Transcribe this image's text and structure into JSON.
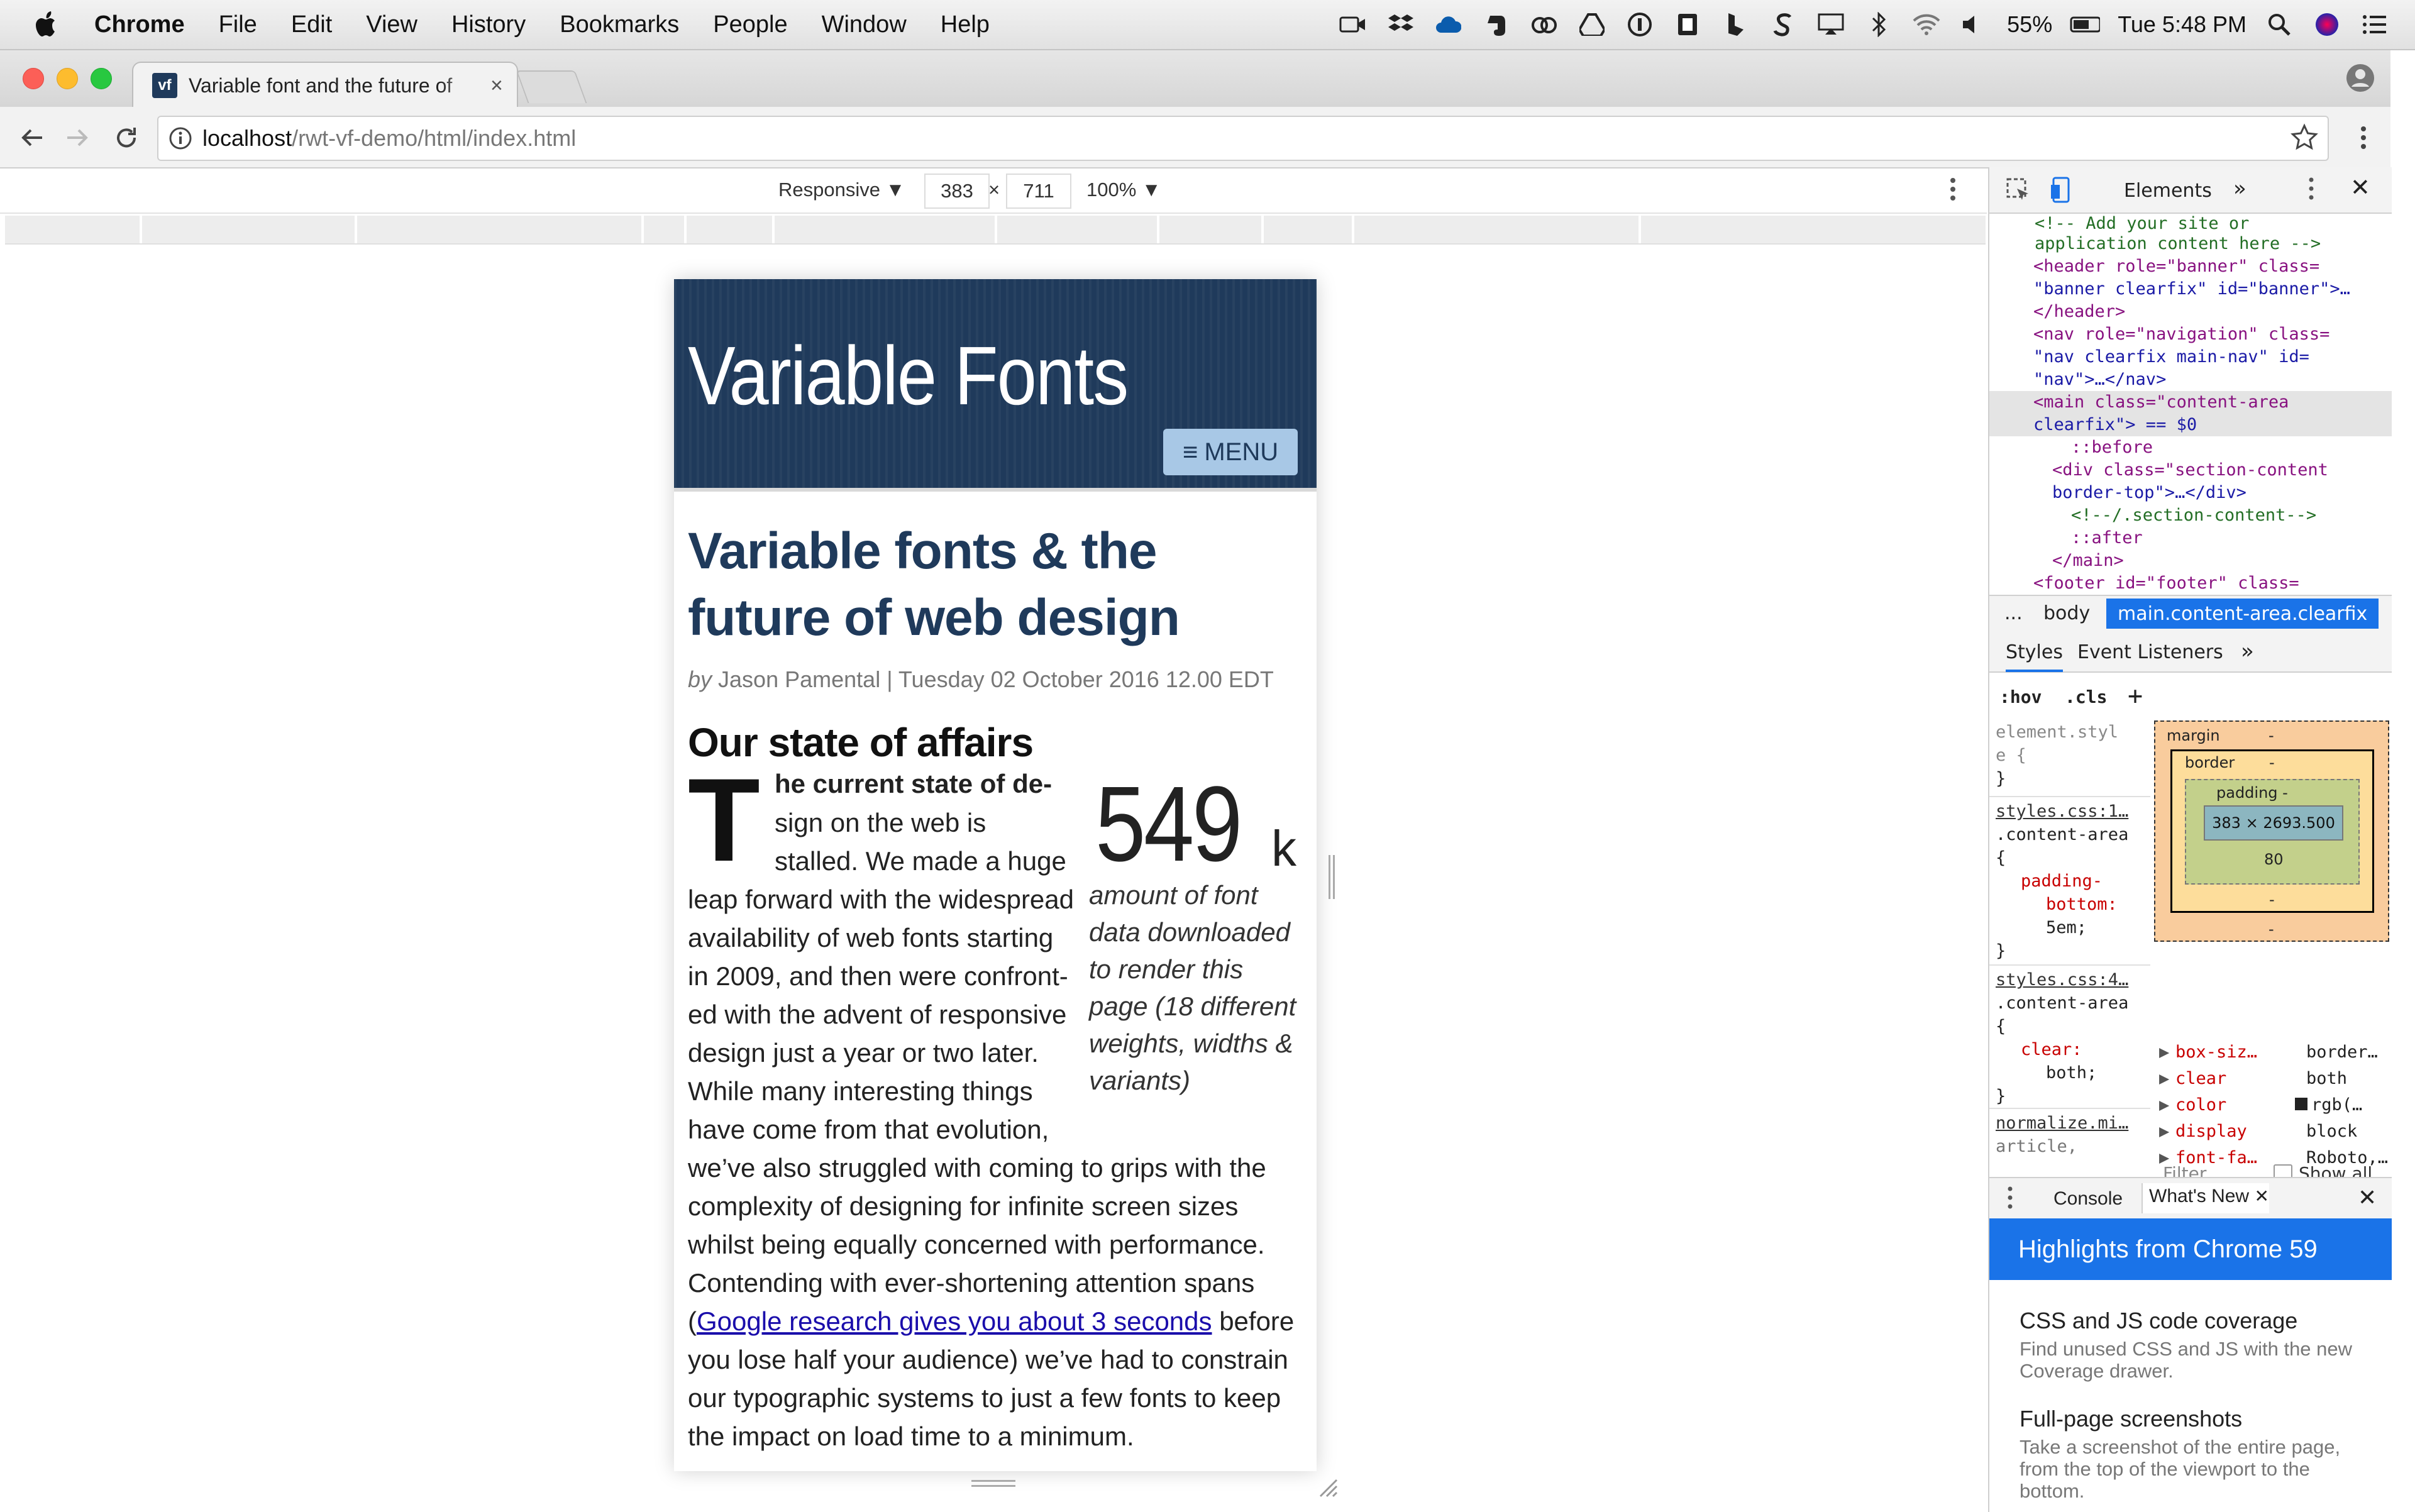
{
  "menubar": {
    "app": "Chrome",
    "items": [
      "File",
      "Edit",
      "View",
      "History",
      "Bookmarks",
      "People",
      "Window",
      "Help"
    ],
    "battery": "55%",
    "clock": "Tue 5:48 PM"
  },
  "browser": {
    "tab_title": "Variable font and the future of",
    "favicon_text": "vf",
    "url_host": "localhost",
    "url_path": "/rwt-vf-demo/html/index.html"
  },
  "device_toolbar": {
    "mode": "Responsive ▼",
    "width": "383",
    "times": "×",
    "height": "711",
    "zoom": "100% ▼"
  },
  "site": {
    "title": "Variable Fonts",
    "menu_label": "MENU",
    "article_title_line1": "Variable fonts & the",
    "article_title_line2": "future of web design",
    "byline_by": "by",
    "byline_rest": " Jason Pamental | Tuesday 02 October 2016 12.00 EDT",
    "section_heading": "Our state of affairs",
    "dropcap": "T",
    "lines": [
      "he current state of de-",
      "sign on the web is",
      "stalled. We made a huge",
      "leap forward with the widespread",
      "availability of web fonts starting",
      "in 2009, and then were confront-",
      "ed with the advent of responsive",
      "design just a year or two later.",
      "While many interesting things",
      "have come from that evolution,",
      "we’ve also struggled with coming to grips with the",
      "complexity of designing for infinite screen sizes",
      "whilst being equally concerned with performance.",
      "Contending with ever-shortening attention spans",
      "before",
      "you lose half your audience) we’ve had to constrain",
      "our typographic systems to just a few fonts to keep",
      "the impact on load time to a minimum."
    ],
    "link_open_paren": "(",
    "link_text": "Google research gives you about 3 seconds",
    "stat_number": "549",
    "stat_unit": "k",
    "stat_caption": "amount of font data downloaded to render this page (18 different weights, widths & variants)"
  },
  "devtools": {
    "tab_elements": "Elements",
    "dom": [
      "<!-- Add your site or",
      "application content here -->",
      "<header role=\"banner\" class=",
      "\"banner clearfix\" id=\"banner\">…",
      "</header>",
      "<nav role=\"navigation\" class=",
      "\"nav clearfix main-nav\" id=",
      "\"nav\">…</nav>",
      "<main class=\"content-area",
      "clearfix\"> == $0",
      "::before",
      "<div class=\"section-content",
      "border-top\">…</div>",
      "<!--/.section-content-->",
      "::after",
      "</main>",
      "<footer id=\"footer\" class="
    ],
    "crumbs": [
      "...",
      "body",
      "main.content-area.clearfix"
    ],
    "styles_tabs": [
      "Styles",
      "Event Listeners"
    ],
    "hov": ":hov",
    "cls": ".cls",
    "rules": {
      "element_style_l1": "element.styl",
      "element_style_l2": "e {",
      "element_style_l3": "}",
      "r1_src": "styles.css:1…",
      "r1_sel": ".content-area",
      "r1_open": "{",
      "r1_prop_a": "padding-",
      "r1_prop_b": "bottom:",
      "r1_val": "5em;",
      "r1_close": "}",
      "r2_src": "styles.css:4…",
      "r2_sel": ".content-area",
      "r2_open": "{",
      "r2_prop": "clear:",
      "r2_val": "both;",
      "r2_close": "}",
      "r3_src": "normalize.mi…",
      "r3_sel": "article,"
    },
    "boxmodel": {
      "margin": "margin",
      "border": "border",
      "padding": "padding -",
      "dash": "-",
      "content": "383 × 2693.500",
      "bottom_padding": "80"
    },
    "computed": {
      "filter": "Filter",
      "show_all": "Show all",
      "rows": [
        {
          "prop": "box-siz…",
          "val": "border…"
        },
        {
          "prop": "clear",
          "val": "both"
        },
        {
          "prop": "color",
          "val": "rgb(…"
        },
        {
          "prop": "display",
          "val": "block"
        },
        {
          "prop": "font-fa…",
          "val": "Roboto,…"
        }
      ]
    },
    "drawer_tabs": [
      "Console",
      "What's New"
    ],
    "banner": "Highlights from Chrome 59",
    "news": [
      {
        "title": "CSS and JS code coverage",
        "desc": "Find unused CSS and JS with the new Coverage drawer."
      },
      {
        "title": "Full-page screenshots",
        "desc": "Take a screenshot of the entire page, from the top of the viewport to the bottom."
      }
    ]
  }
}
